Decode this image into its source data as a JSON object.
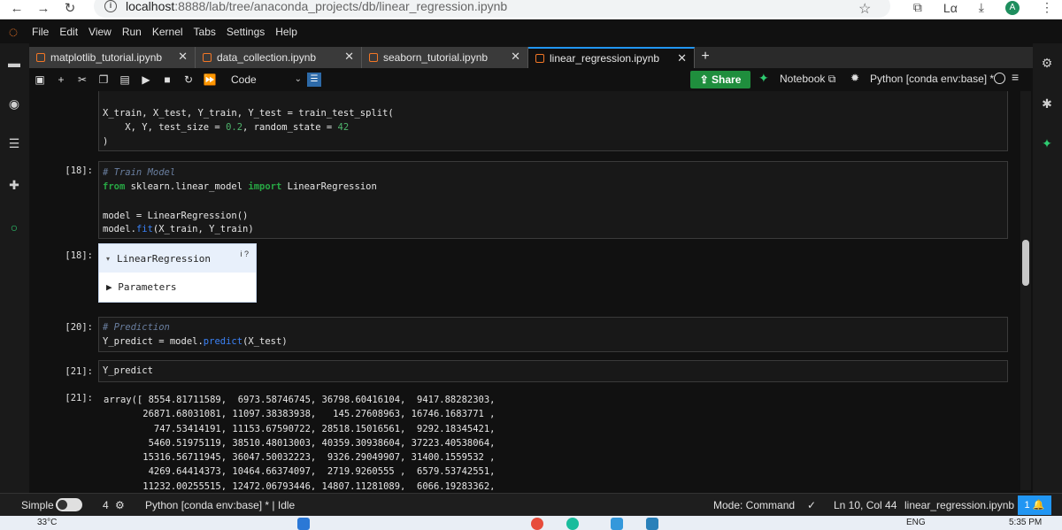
{
  "browser": {
    "url_prefix": "localhost",
    "url_rest": ":8888/lab/tree/anaconda_projects/db/linear_regression.ipynb",
    "avatar_letter": "A"
  },
  "menu": [
    "File",
    "Edit",
    "View",
    "Run",
    "Kernel",
    "Tabs",
    "Settings",
    "Help"
  ],
  "tabs": [
    {
      "label": "matplotlib_tutorial.ipynb"
    },
    {
      "label": "data_collection.ipynb"
    },
    {
      "label": "seaborn_tutorial.ipynb"
    },
    {
      "label": "linear_regression.ipynb"
    }
  ],
  "toolbar": {
    "cell_type": "Code",
    "share_label": "Share",
    "notebook_label": "Notebook",
    "kernel_label": "Python [conda env:base] *"
  },
  "cells": {
    "c0_line1": "X_train, X_test, Y_train, Y_test = train_test_split(",
    "c0_line2a": "    X, Y, test_size = ",
    "c0_line2b": "0.2",
    "c0_line2c": ", random_state = ",
    "c0_line2d": "42",
    "c0_line3": ")",
    "p18": "[18]:",
    "c1_comment": "# Train Model",
    "c1_from": "from",
    "c1_module": " sklearn.linear_model ",
    "c1_import": "import",
    "c1_name": " LinearRegression",
    "c1_l3": "model = LinearRegression()",
    "c1_l4a": "model.",
    "c1_l4b": "fit",
    "c1_l4c": "(X_train, Y_train)",
    "out18": "[18]:",
    "widget_title": "LinearRegression",
    "widget_badges": "i ?",
    "widget_param": "Parameters",
    "p20": "[20]:",
    "c2_comment": "# Prediction",
    "c2_l2a": "Y_predict = model.",
    "c2_l2b": "predict",
    "c2_l2c": "(X_test)",
    "p21": "[21]:",
    "c3_l1": "Y_predict",
    "out21": "[21]:",
    "output_lines": [
      "array([ 8554.81711589,  6973.58746745, 36798.60416104,  9417.88282303,",
      "       26871.68031081, 11097.38383938,   145.27608963, 16746.1683771 ,",
      "         747.53414191, 11153.67590722, 28518.15016561,  9292.18345421,",
      "        5460.51975119, 38510.48013003, 40359.30938604, 37223.40538064,",
      "       15316.56711945, 36047.50032223,  9326.29049907, 31400.1559532 ,",
      "        4269.64414373, 10464.66374097,  2719.9260555 ,  6579.53742551,",
      "       11232.00255515, 12472.06793446, 14807.11281089,  6066.19283362,"
    ]
  },
  "status": {
    "simple": "Simple",
    "count": "4",
    "kernel_state": "Python [conda env:base] * | Idle",
    "mode": "Mode: Command",
    "position": "Ln 10, Col 44",
    "filename": "linear_regression.ipynb",
    "bell_count": "1"
  },
  "taskbar": {
    "temperature": "33°C",
    "lang": "ENG",
    "time": "5:35 PM"
  },
  "colors": {
    "accent": "#2196f3",
    "share": "#1f8e3d",
    "jupyter": "#f37726"
  }
}
